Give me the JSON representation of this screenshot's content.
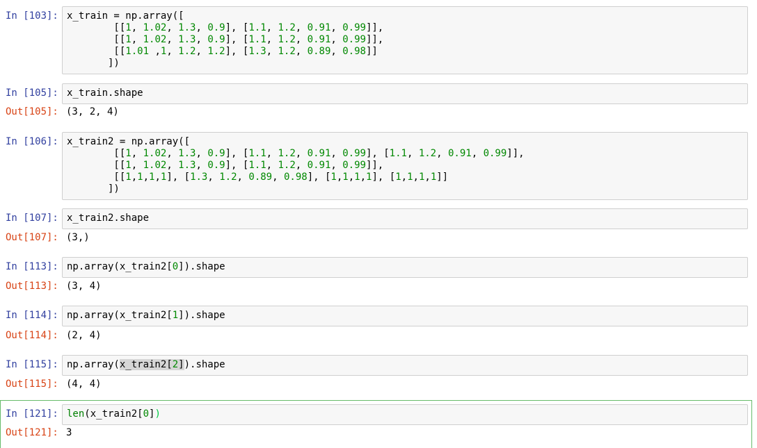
{
  "cells": [
    {
      "in_prompt": "In [103]:",
      "code_lines": [
        [
          {
            "t": "x_train = np.array(["
          }
        ],
        [
          {
            "t": "        [["
          },
          {
            "t": "1",
            "c": "n"
          },
          {
            "t": ", "
          },
          {
            "t": "1.02",
            "c": "n"
          },
          {
            "t": ", "
          },
          {
            "t": "1.3",
            "c": "n"
          },
          {
            "t": ", "
          },
          {
            "t": "0.9",
            "c": "n"
          },
          {
            "t": "], ["
          },
          {
            "t": "1.1",
            "c": "n"
          },
          {
            "t": ", "
          },
          {
            "t": "1.2",
            "c": "n"
          },
          {
            "t": ", "
          },
          {
            "t": "0.91",
            "c": "n"
          },
          {
            "t": ", "
          },
          {
            "t": "0.99",
            "c": "n"
          },
          {
            "t": "]],"
          }
        ],
        [
          {
            "t": "        [["
          },
          {
            "t": "1",
            "c": "n"
          },
          {
            "t": ", "
          },
          {
            "t": "1.02",
            "c": "n"
          },
          {
            "t": ", "
          },
          {
            "t": "1.3",
            "c": "n"
          },
          {
            "t": ", "
          },
          {
            "t": "0.9",
            "c": "n"
          },
          {
            "t": "], ["
          },
          {
            "t": "1.1",
            "c": "n"
          },
          {
            "t": ", "
          },
          {
            "t": "1.2",
            "c": "n"
          },
          {
            "t": ", "
          },
          {
            "t": "0.91",
            "c": "n"
          },
          {
            "t": ", "
          },
          {
            "t": "0.99",
            "c": "n"
          },
          {
            "t": "]],"
          }
        ],
        [
          {
            "t": "        [["
          },
          {
            "t": "1.01",
            "c": "n"
          },
          {
            "t": " ,"
          },
          {
            "t": "1",
            "c": "n"
          },
          {
            "t": ", "
          },
          {
            "t": "1.2",
            "c": "n"
          },
          {
            "t": ", "
          },
          {
            "t": "1.2",
            "c": "n"
          },
          {
            "t": "], ["
          },
          {
            "t": "1.3",
            "c": "n"
          },
          {
            "t": ", "
          },
          {
            "t": "1.2",
            "c": "n"
          },
          {
            "t": ", "
          },
          {
            "t": "0.89",
            "c": "n"
          },
          {
            "t": ", "
          },
          {
            "t": "0.98",
            "c": "n"
          },
          {
            "t": "]]"
          }
        ],
        [
          {
            "t": "       ])"
          }
        ]
      ],
      "out_prompt": "",
      "output": ""
    },
    {
      "in_prompt": "In [105]:",
      "code_lines": [
        [
          {
            "t": "x_train.shape"
          }
        ]
      ],
      "out_prompt": "Out[105]:",
      "output": "(3, 2, 4)"
    },
    {
      "in_prompt": "In [106]:",
      "code_lines": [
        [
          {
            "t": "x_train2 = np.array(["
          }
        ],
        [
          {
            "t": "        [["
          },
          {
            "t": "1",
            "c": "n"
          },
          {
            "t": ", "
          },
          {
            "t": "1.02",
            "c": "n"
          },
          {
            "t": ", "
          },
          {
            "t": "1.3",
            "c": "n"
          },
          {
            "t": ", "
          },
          {
            "t": "0.9",
            "c": "n"
          },
          {
            "t": "], ["
          },
          {
            "t": "1.1",
            "c": "n"
          },
          {
            "t": ", "
          },
          {
            "t": "1.2",
            "c": "n"
          },
          {
            "t": ", "
          },
          {
            "t": "0.91",
            "c": "n"
          },
          {
            "t": ", "
          },
          {
            "t": "0.99",
            "c": "n"
          },
          {
            "t": "], ["
          },
          {
            "t": "1.1",
            "c": "n"
          },
          {
            "t": ", "
          },
          {
            "t": "1.2",
            "c": "n"
          },
          {
            "t": ", "
          },
          {
            "t": "0.91",
            "c": "n"
          },
          {
            "t": ", "
          },
          {
            "t": "0.99",
            "c": "n"
          },
          {
            "t": "]],"
          }
        ],
        [
          {
            "t": "        [["
          },
          {
            "t": "1",
            "c": "n"
          },
          {
            "t": ", "
          },
          {
            "t": "1.02",
            "c": "n"
          },
          {
            "t": ", "
          },
          {
            "t": "1.3",
            "c": "n"
          },
          {
            "t": ", "
          },
          {
            "t": "0.9",
            "c": "n"
          },
          {
            "t": "], ["
          },
          {
            "t": "1.1",
            "c": "n"
          },
          {
            "t": ", "
          },
          {
            "t": "1.2",
            "c": "n"
          },
          {
            "t": ", "
          },
          {
            "t": "0.91",
            "c": "n"
          },
          {
            "t": ", "
          },
          {
            "t": "0.99",
            "c": "n"
          },
          {
            "t": "]],"
          }
        ],
        [
          {
            "t": "        [["
          },
          {
            "t": "1",
            "c": "n"
          },
          {
            "t": ","
          },
          {
            "t": "1",
            "c": "n"
          },
          {
            "t": ","
          },
          {
            "t": "1",
            "c": "n"
          },
          {
            "t": ","
          },
          {
            "t": "1",
            "c": "n"
          },
          {
            "t": "], ["
          },
          {
            "t": "1.3",
            "c": "n"
          },
          {
            "t": ", "
          },
          {
            "t": "1.2",
            "c": "n"
          },
          {
            "t": ", "
          },
          {
            "t": "0.89",
            "c": "n"
          },
          {
            "t": ", "
          },
          {
            "t": "0.98",
            "c": "n"
          },
          {
            "t": "], ["
          },
          {
            "t": "1",
            "c": "n"
          },
          {
            "t": ","
          },
          {
            "t": "1",
            "c": "n"
          },
          {
            "t": ","
          },
          {
            "t": "1",
            "c": "n"
          },
          {
            "t": ","
          },
          {
            "t": "1",
            "c": "n"
          },
          {
            "t": "], ["
          },
          {
            "t": "1",
            "c": "n"
          },
          {
            "t": ","
          },
          {
            "t": "1",
            "c": "n"
          },
          {
            "t": ","
          },
          {
            "t": "1",
            "c": "n"
          },
          {
            "t": ","
          },
          {
            "t": "1",
            "c": "n"
          },
          {
            "t": "]]"
          }
        ],
        [
          {
            "t": "       ])"
          }
        ]
      ],
      "out_prompt": "",
      "output": ""
    },
    {
      "in_prompt": "In [107]:",
      "code_lines": [
        [
          {
            "t": "x_train2.shape"
          }
        ]
      ],
      "out_prompt": "Out[107]:",
      "output": "(3,)"
    },
    {
      "in_prompt": "In [113]:",
      "code_lines": [
        [
          {
            "t": "np.array(x_train2["
          },
          {
            "t": "0",
            "c": "n"
          },
          {
            "t": "]).shape"
          }
        ]
      ],
      "out_prompt": "Out[113]:",
      "output": "(3, 4)"
    },
    {
      "in_prompt": "In [114]:",
      "code_lines": [
        [
          {
            "t": "np.array(x_train2["
          },
          {
            "t": "1",
            "c": "n"
          },
          {
            "t": "]).shape"
          }
        ]
      ],
      "out_prompt": "Out[114]:",
      "output": "(2, 4)"
    },
    {
      "in_prompt": "In [115]:",
      "code_lines": [
        [
          {
            "t": "np.array("
          },
          {
            "t": "x_train2[",
            "c": "bm"
          },
          {
            "t": "2",
            "c": "bmn"
          },
          {
            "t": "]",
            "c": "bm"
          },
          {
            "t": ").shape"
          }
        ]
      ],
      "out_prompt": "Out[115]:",
      "output": "(4, 4)"
    },
    {
      "in_prompt": "In [121]:",
      "code_lines": [
        [
          {
            "t": "len",
            "c": "fn"
          },
          {
            "t": "(x_train2["
          },
          {
            "t": "0",
            "c": "n"
          },
          {
            "t": "]"
          },
          {
            "t": ")",
            "c": "cursor"
          }
        ]
      ],
      "out_prompt": "Out[121]:",
      "output": "3",
      "selected": true
    }
  ],
  "colors": {
    "in_prompt": "#303f9f",
    "out_prompt": "#d84315",
    "number": "#008800",
    "input_bg": "#f7f7f7",
    "input_border": "#cfcfcf",
    "selected_border": "#66bb6a"
  }
}
